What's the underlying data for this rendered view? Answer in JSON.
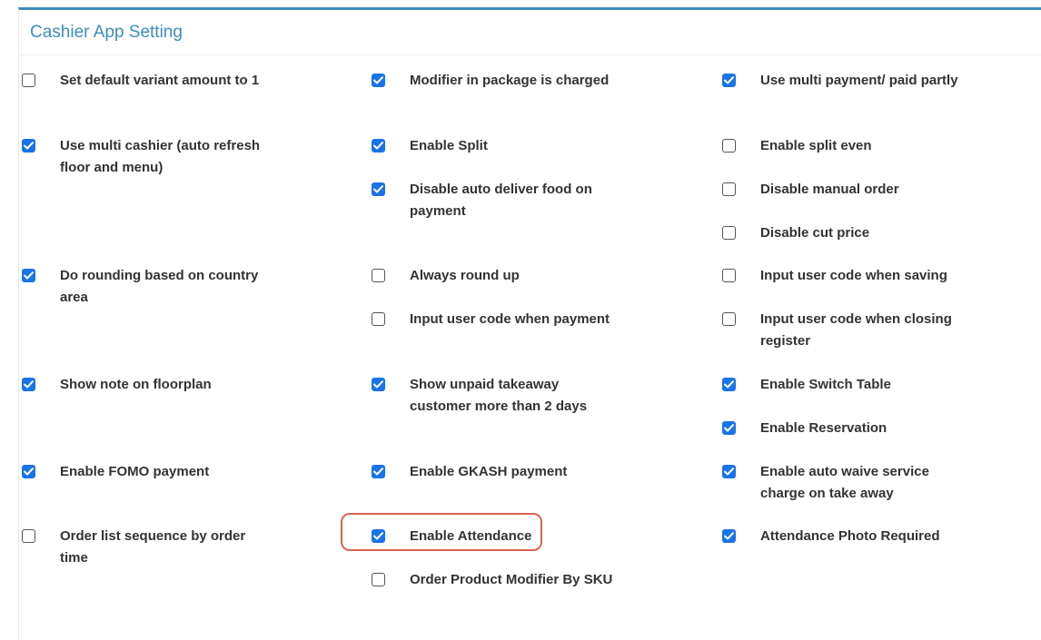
{
  "panel": {
    "title": "Cashier App Setting"
  },
  "accent": "#3c8dbc",
  "check_color": "#1a73e8",
  "highlight_color": "#d9634e",
  "options": {
    "c1": [
      {
        "label": "Set default variant amount to 1",
        "checked": false
      },
      {
        "label": "Use multi cashier (auto refresh floor and menu)",
        "checked": true
      },
      {
        "label": "Do rounding based on country area",
        "checked": true
      },
      {
        "label": "Show note on floorplan",
        "checked": true
      },
      {
        "label": "Enable FOMO payment",
        "checked": true
      },
      {
        "label": "Order list sequence by order time",
        "checked": false
      }
    ],
    "c2": [
      {
        "label": "Modifier in package is charged",
        "checked": true
      },
      {
        "label": "Enable Split",
        "checked": true
      },
      {
        "label": "Disable auto deliver food on payment",
        "checked": true
      },
      {
        "label": "Always round up",
        "checked": false
      },
      {
        "label": "Input user code when payment",
        "checked": false
      },
      {
        "label": "Show unpaid takeaway customer more than 2 days",
        "checked": true
      },
      {
        "label": "Enable GKASH payment",
        "checked": true
      },
      {
        "label": "Enable Attendance",
        "checked": true,
        "highlighted": true
      },
      {
        "label": "Order Product Modifier By SKU",
        "checked": false
      }
    ],
    "c3": [
      {
        "label": "Use multi payment/ paid partly",
        "checked": true
      },
      {
        "label": "Enable split even",
        "checked": false
      },
      {
        "label": "Disable manual order",
        "checked": false
      },
      {
        "label": "Disable cut price",
        "checked": false
      },
      {
        "label": "Input user code when saving",
        "checked": false
      },
      {
        "label": "Input user code when closing register",
        "checked": false
      },
      {
        "label": "Enable Switch Table",
        "checked": true
      },
      {
        "label": "Enable Reservation",
        "checked": true
      },
      {
        "label": "Enable auto waive service charge on take away",
        "checked": true
      },
      {
        "label": "Attendance Photo Required",
        "checked": true
      }
    ]
  }
}
